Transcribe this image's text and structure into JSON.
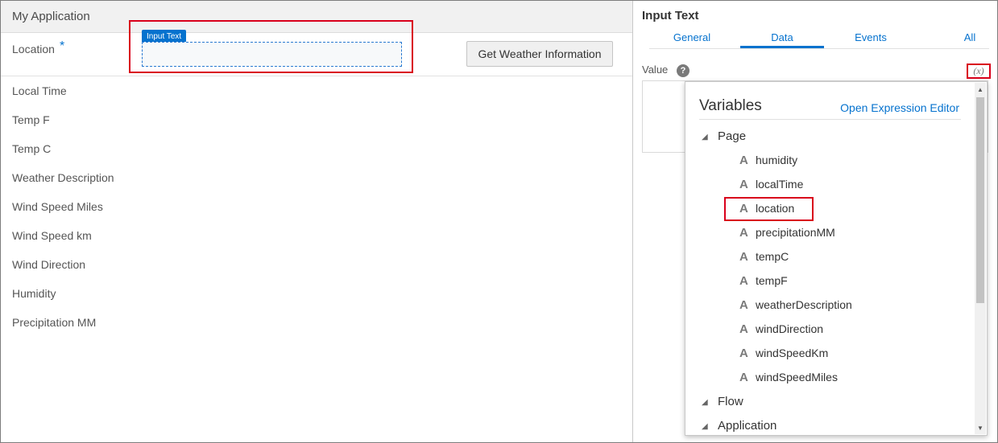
{
  "app": {
    "title": "My Application"
  },
  "form": {
    "location_label": "Location",
    "required_mark": "*",
    "input_tag": "Input Text",
    "input_value": "",
    "weather_button": "Get Weather Information",
    "fields": [
      "Local Time",
      "Temp F",
      "Temp C",
      "Weather Description",
      "Wind Speed Miles",
      "Wind Speed km",
      "Wind Direction",
      "Humidity",
      "Precipitation MM"
    ]
  },
  "panel": {
    "title": "Input Text",
    "tabs": [
      "General",
      "Data",
      "Events",
      "All"
    ],
    "active_tab": "Data",
    "value_label": "Value",
    "help_glyph": "?",
    "expr_glyph": "(x)"
  },
  "variables": {
    "title": "Variables",
    "link": "Open Expression Editor",
    "groups": [
      "Page",
      "Flow",
      "Application"
    ],
    "page_vars": [
      "humidity",
      "localTime",
      "location",
      "precipitationMM",
      "tempC",
      "tempF",
      "weatherDescription",
      "windDirection",
      "windSpeedKm",
      "windSpeedMiles"
    ],
    "selected": "location",
    "type_icon_glyph": "A",
    "expand_glyph": "◢",
    "scroll_up_glyph": "▲",
    "scroll_down_glyph": "▼"
  },
  "colors": {
    "accent": "#0572ce",
    "highlight": "#d9001b"
  }
}
